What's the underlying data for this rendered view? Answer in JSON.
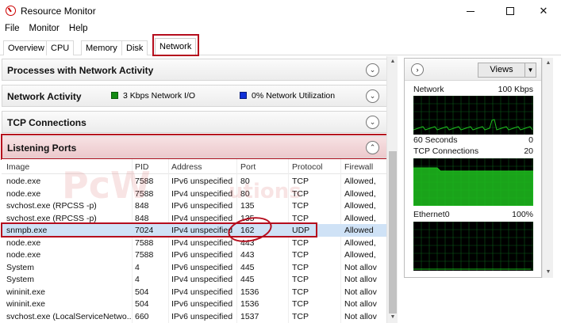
{
  "window": {
    "title": "Resource Monitor",
    "controls": {
      "minimize": "",
      "maximize": "",
      "close": "✕"
    }
  },
  "menu": [
    "File",
    "Monitor",
    "Help"
  ],
  "tabs": [
    {
      "label": "Overview",
      "active": false
    },
    {
      "label": "CPU",
      "active": false
    },
    {
      "label": "Memory",
      "active": false
    },
    {
      "label": "Disk",
      "active": false
    },
    {
      "label": "Network",
      "active": true
    }
  ],
  "panels": {
    "processes": {
      "title": "Processes with Network Activity",
      "expanded": false
    },
    "network_activity": {
      "title": "Network Activity",
      "io_text": "3 Kbps Network I/O",
      "io_color": "#138a13",
      "util_text": "0% Network Utilization",
      "util_color": "#1030d8",
      "expanded": false
    },
    "tcp": {
      "title": "TCP Connections",
      "expanded": false
    },
    "listening": {
      "title": "Listening Ports",
      "expanded": true
    }
  },
  "listening_table": {
    "columns": [
      "Image",
      "PID",
      "Address",
      "Port",
      "Protocol",
      "Firewall"
    ],
    "rows": [
      [
        "node.exe",
        "7588",
        "IPv6 unspecified",
        "80",
        "TCP",
        "Allowed,"
      ],
      [
        "node.exe",
        "7588",
        "IPv4 unspecified",
        "80",
        "TCP",
        "Allowed,"
      ],
      [
        "svchost.exe (RPCSS -p)",
        "848",
        "IPv6 unspecified",
        "135",
        "TCP",
        "Allowed,"
      ],
      [
        "svchost.exe (RPCSS -p)",
        "848",
        "IPv4 unspecified",
        "135",
        "TCP",
        "Allowed,"
      ],
      [
        "snmpb.exe",
        "7024",
        "IPv4 unspecified",
        "162",
        "UDP",
        "Allowed"
      ],
      [
        "node.exe",
        "7588",
        "IPv4 unspecified",
        "443",
        "TCP",
        "Allowed,"
      ],
      [
        "node.exe",
        "7588",
        "IPv6 unspecified",
        "443",
        "TCP",
        "Allowed,"
      ],
      [
        "System",
        "4",
        "IPv6 unspecified",
        "445",
        "TCP",
        "Not allov"
      ],
      [
        "System",
        "4",
        "IPv4 unspecified",
        "445",
        "TCP",
        "Not allov"
      ],
      [
        "wininit.exe",
        "504",
        "IPv4 unspecified",
        "1536",
        "TCP",
        "Not allov"
      ],
      [
        "wininit.exe",
        "504",
        "IPv6 unspecified",
        "1536",
        "TCP",
        "Not allov"
      ],
      [
        "svchost.exe (LocalServiceNetwo...",
        "660",
        "IPv6 unspecified",
        "1537",
        "TCP",
        "Not allov"
      ]
    ],
    "selected_row": 4
  },
  "watermark": {
    "text1": "PcW",
    "text2": "utions"
  },
  "right_pane": {
    "views_label": "Views",
    "graphs": [
      {
        "name": "Network",
        "max": "100 Kbps",
        "footer_left": "60 Seconds",
        "footer_right": "0"
      },
      {
        "name": "TCP Connections",
        "max": "20",
        "footer_left": "",
        "footer_right": ""
      },
      {
        "name": "Ethernet0",
        "max": "100%",
        "footer_left": "",
        "footer_right": ""
      }
    ],
    "graph_color": "#1fbf1f",
    "grid_color": "#0b5a18"
  }
}
